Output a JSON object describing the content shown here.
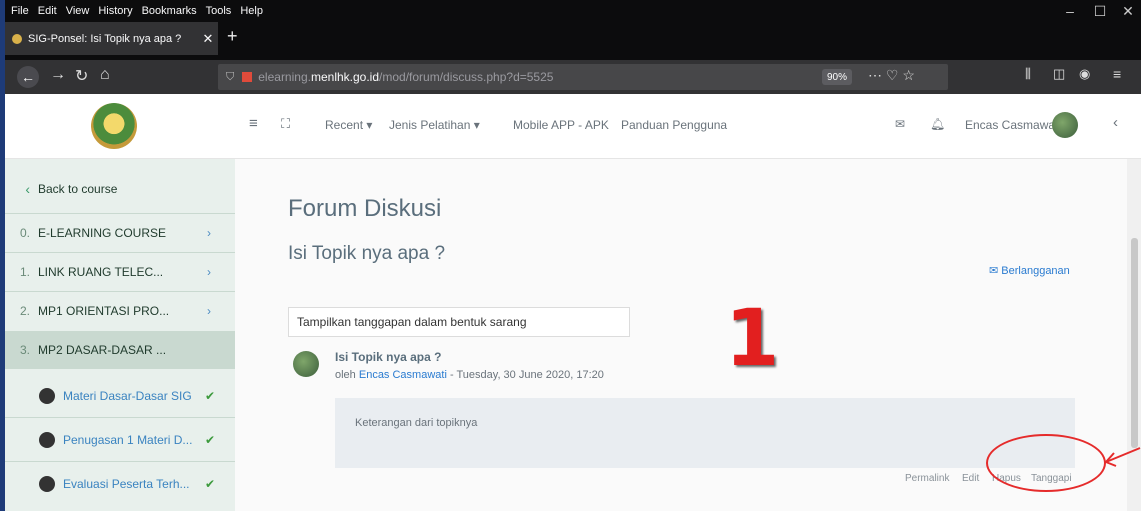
{
  "browser": {
    "menu": [
      "File",
      "Edit",
      "View",
      "History",
      "Bookmarks",
      "Tools",
      "Help"
    ],
    "tab_title": "SIG-Ponsel: Isi Topik nya apa ?",
    "tab_close": "✕",
    "new_tab": "+",
    "url_prefix": "elearning.",
    "url_domain": "menlhk.go.id",
    "url_path": "/mod/forum/discuss.php?d=5525",
    "zoom": "90%"
  },
  "header": {
    "nav": [
      "Recent ▾",
      "Jenis Pelatihan ▾",
      "Mobile APP - APK",
      "Panduan Pengguna"
    ],
    "user": "Encas Casmawati"
  },
  "sidebar": {
    "back": "Back to course",
    "sections": [
      {
        "num": "0.",
        "label": "E-LEARNING COURSE"
      },
      {
        "num": "1.",
        "label": "LINK RUANG TELEC..."
      },
      {
        "num": "2.",
        "label": "MP1 ORIENTASI PRO..."
      },
      {
        "num": "3.",
        "label": "MP2 DASAR-DASAR ..."
      }
    ],
    "activities": [
      {
        "label": "Materi Dasar-Dasar SIG"
      },
      {
        "label": "Penugasan 1 Materi D..."
      },
      {
        "label": "Evaluasi Peserta Terh..."
      }
    ]
  },
  "main": {
    "title": "Forum Diskusi",
    "topic": "Isi Topik nya apa ?",
    "subscribe": "Berlangganan",
    "display_mode": "Tampilkan tanggapan dalam bentuk sarang",
    "post": {
      "subject": "Isi Topik nya apa ?",
      "by": "oleh",
      "author": "Encas Casmawati",
      "date": " - Tuesday, 30 June 2020, 17:20",
      "body": "Keterangan dari topiknya"
    },
    "actions": [
      "Permalink",
      "Edit",
      "Hapus",
      "Tanggapi"
    ]
  },
  "annotation": {
    "step": "1"
  },
  "colors": {
    "accent": "#2a7bd0",
    "annotation": "#e21f1f",
    "sidebar": "#e8f0ec"
  }
}
